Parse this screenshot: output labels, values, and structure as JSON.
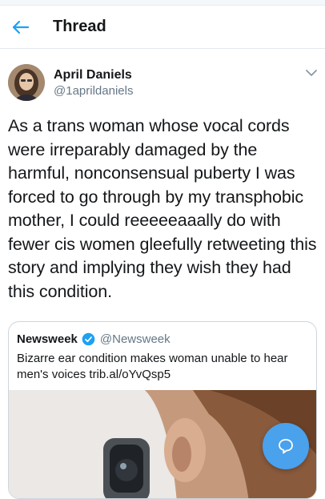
{
  "header": {
    "title": "Thread"
  },
  "tweet": {
    "author_name": "April Daniels",
    "author_handle": "@1aprildaniels",
    "text": "As a trans woman whose vocal cords were irreparably damaged by the harmful, nonconsensual puberty I was forced to go through by my transphobic mother, I could reeeeeaaally do with fewer cis women gleefully retweeting this story and implying they wish they had this condition."
  },
  "quoted_tweet": {
    "author_name": "Newsweek",
    "author_handle": "@Newsweek",
    "text": "Bizarre ear condition makes woman unable to hear men's voices trib.al/oYvQsp5"
  },
  "icons": {
    "back": "arrow-left-icon",
    "caret": "chevron-down-icon",
    "verified": "verified-badge-icon",
    "compose": "reply-bubble-icon"
  },
  "colors": {
    "accent": "#1da1f2",
    "fab": "#4aa1ec",
    "secondary_text": "#657786",
    "border": "#ccd6dd"
  }
}
